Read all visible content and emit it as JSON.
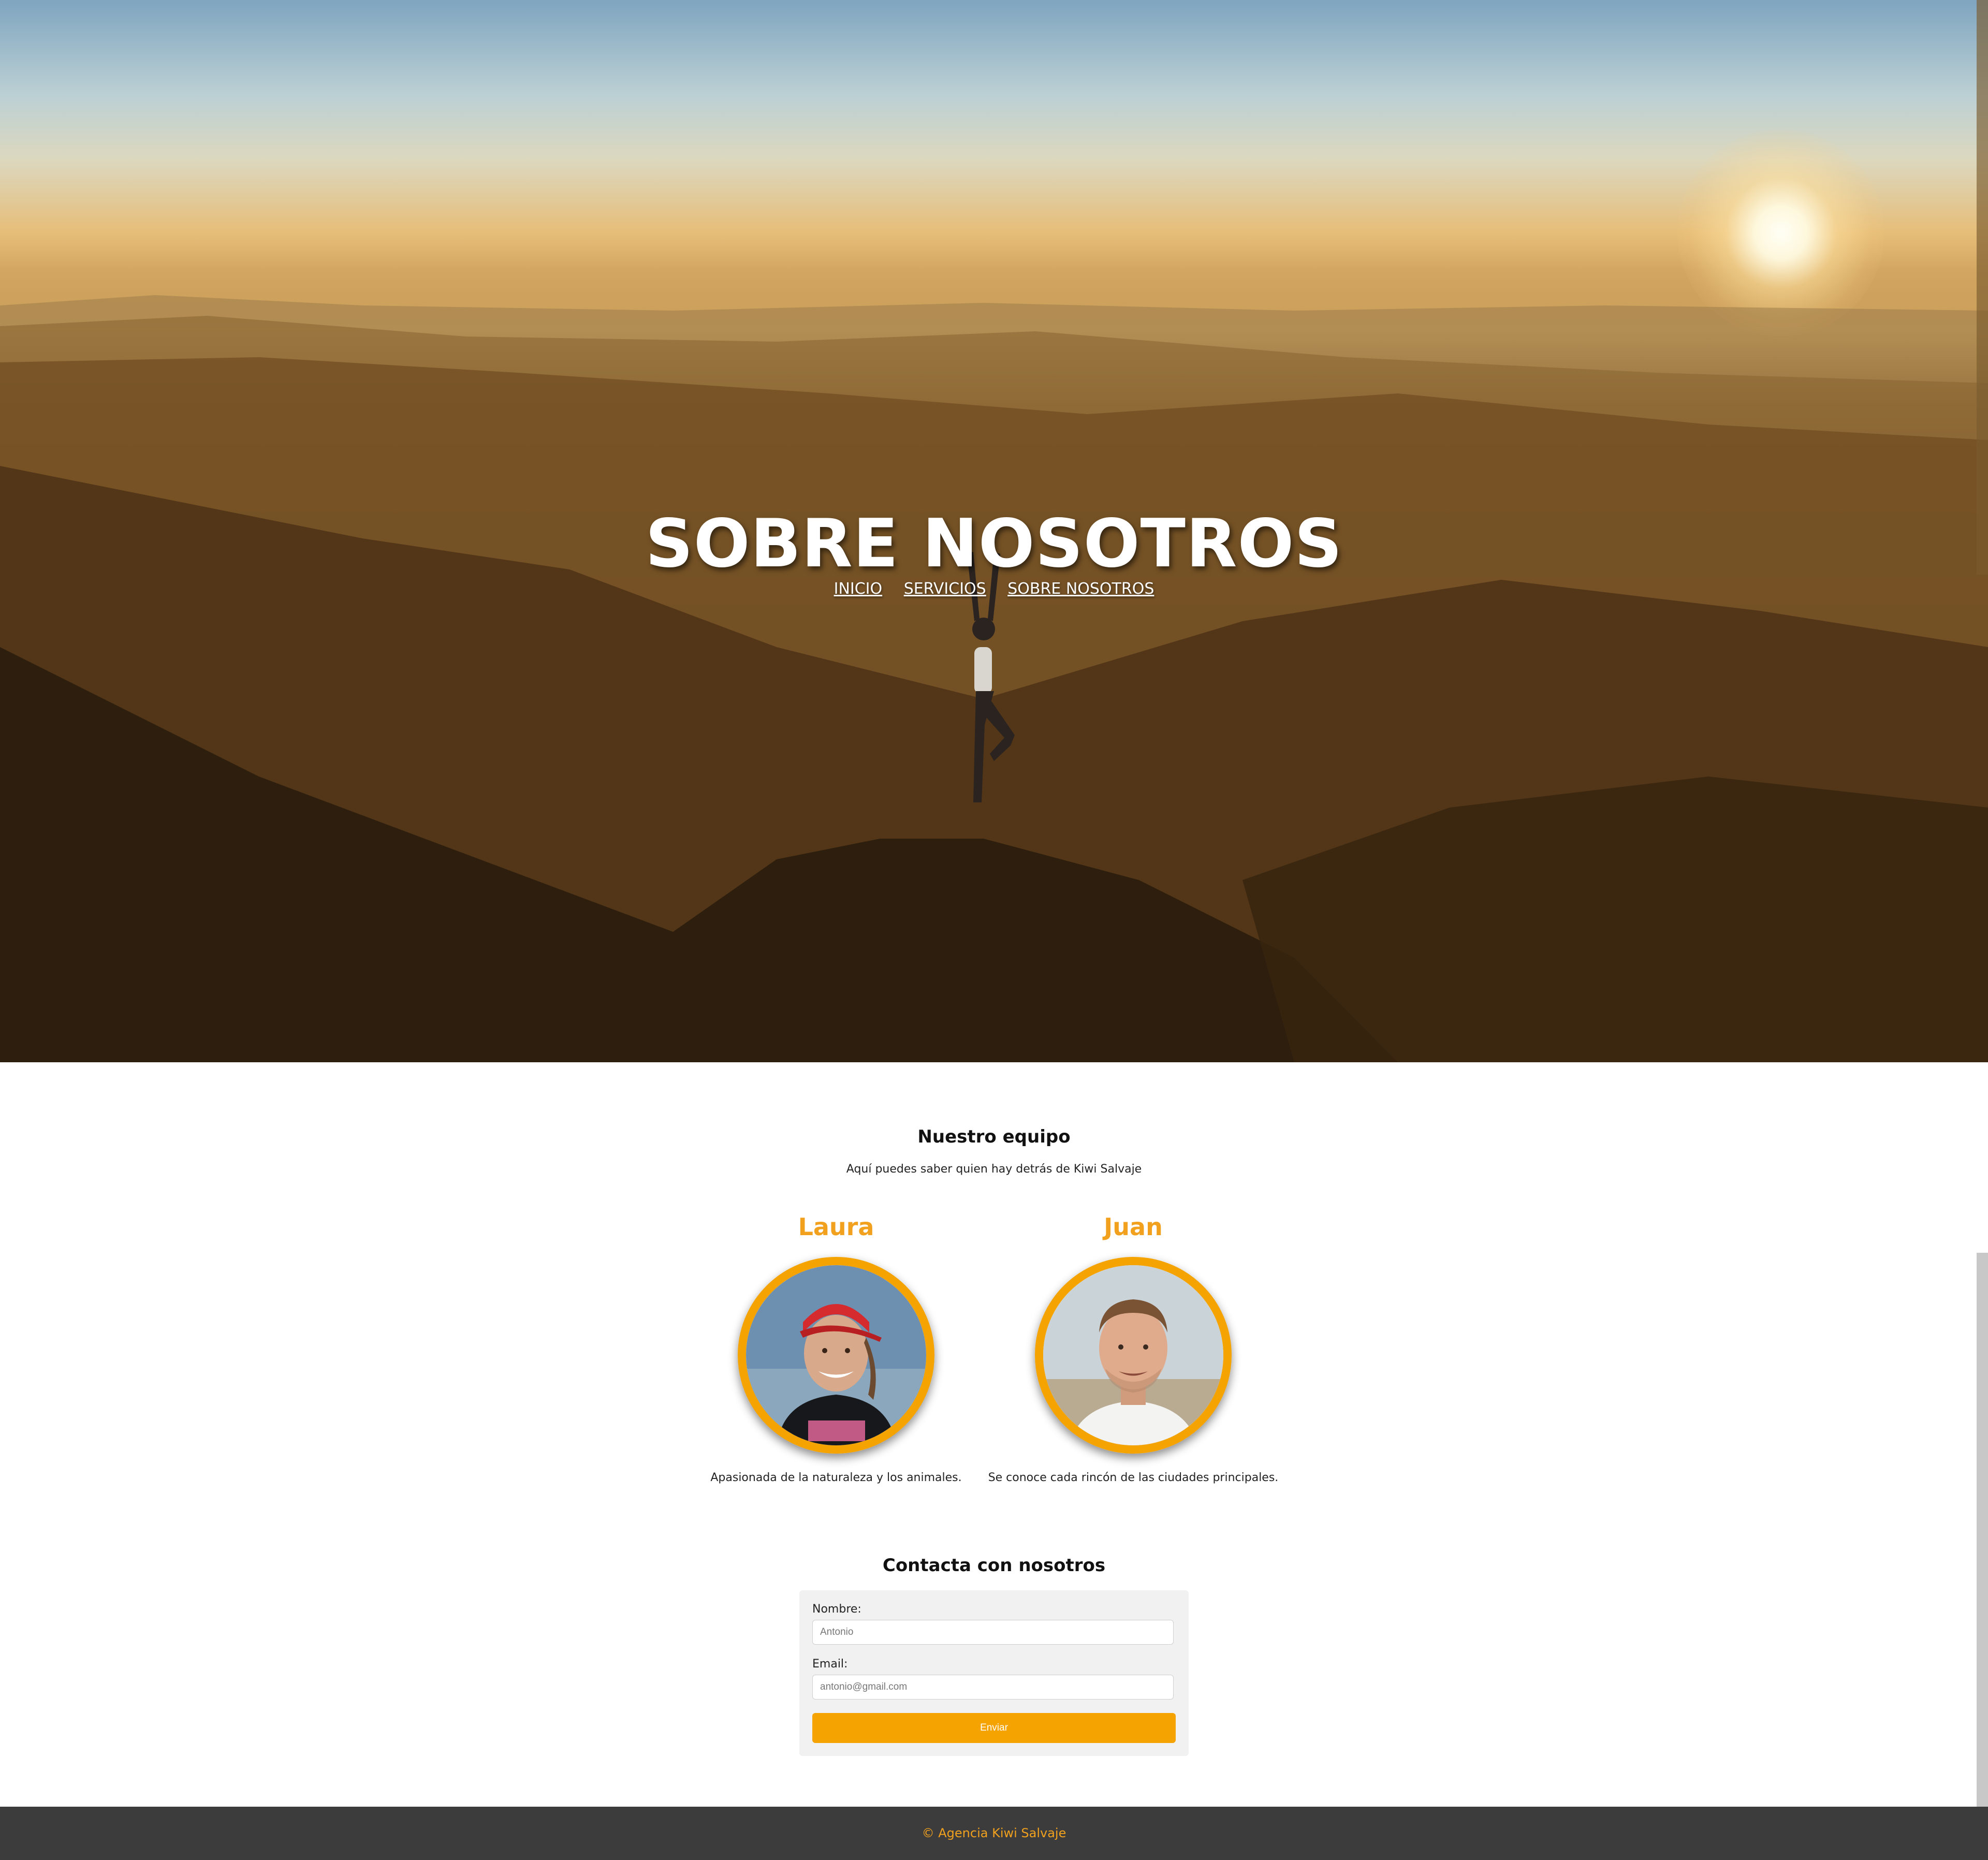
{
  "hero": {
    "title": "SOBRE NOSOTROS",
    "nav": [
      {
        "label": "INICIO"
      },
      {
        "label": "SERVICIOS"
      },
      {
        "label": "SOBRE NOSOTROS"
      }
    ]
  },
  "team": {
    "title": "Nuestro equipo",
    "subtitle": "Aquí puedes saber quien hay detrás de Kiwi Salvaje",
    "members": [
      {
        "name": "Laura",
        "description": "Apasionada de la naturaleza y los animales."
      },
      {
        "name": "Juan",
        "description": "Se conoce cada rincón de las ciudades principales."
      }
    ]
  },
  "contact": {
    "title": "Contacta con nosotros",
    "name_label": "Nombre:",
    "name_placeholder": "Antonio",
    "email_label": "Email:",
    "email_placeholder": "antonio@gmail.com",
    "submit_label": "Enviar"
  },
  "footer": {
    "text": "© Agencia Kiwi Salvaje"
  },
  "colors": {
    "accent": "#f5a300",
    "name_orange": "#f1a11e",
    "footer_bg": "#3c3c3c"
  }
}
